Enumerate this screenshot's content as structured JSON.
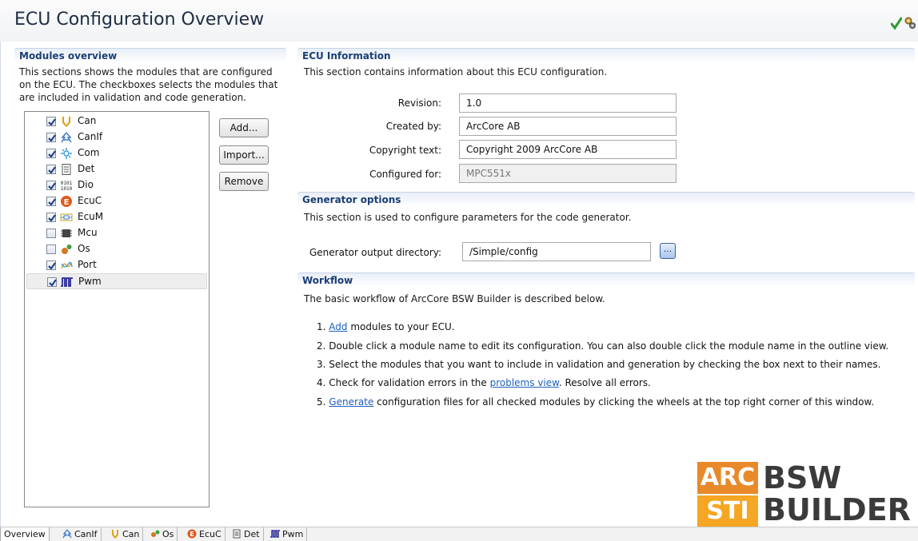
{
  "header": {
    "title": "ECU Configuration Overview"
  },
  "modules_overview": {
    "title": "Modules overview",
    "description_lines": [
      "This sections shows the modules that are configured",
      "on the ECU. The checkboxes selects the modules that",
      "are included in validation and code generation."
    ],
    "modules": [
      {
        "label": "Can",
        "checked": true,
        "icon": "can-icon"
      },
      {
        "label": "CanIf",
        "checked": true,
        "icon": "canif-icon"
      },
      {
        "label": "Com",
        "checked": true,
        "icon": "com-icon"
      },
      {
        "label": "Det",
        "checked": true,
        "icon": "det-icon"
      },
      {
        "label": "Dio",
        "checked": true,
        "icon": "dio-icon"
      },
      {
        "label": "EcuC",
        "checked": true,
        "icon": "ecuc-icon"
      },
      {
        "label": "EcuM",
        "checked": true,
        "icon": "ecum-icon"
      },
      {
        "label": "Mcu",
        "checked": false,
        "icon": "mcu-icon"
      },
      {
        "label": "Os",
        "checked": false,
        "icon": "os-icon"
      },
      {
        "label": "Port",
        "checked": true,
        "icon": "port-icon"
      },
      {
        "label": "Pwm",
        "checked": true,
        "icon": "pwm-icon",
        "selected": true
      }
    ],
    "buttons": {
      "add": "Add...",
      "import": "Import...",
      "remove": "Remove"
    }
  },
  "ecu_info": {
    "title": "ECU Information",
    "description": "This section contains information about this ECU configuration.",
    "revision_label": "Revision:",
    "revision_value": "1.0",
    "created_by_label": "Created by:",
    "created_by_value": "ArcCore AB",
    "copyright_label": "Copyright text:",
    "copyright_value": "Copyright 2009 ArcCore AB",
    "configured_for_label": "Configured for:",
    "configured_for_value": "MPC551x"
  },
  "generator": {
    "title": "Generator options",
    "description": "This section is used to configure parameters for the code generator.",
    "output_dir_label": "Generator output directory:",
    "output_dir_value": "/Simple/config",
    "browse_label": "..."
  },
  "workflow": {
    "title": "Workflow",
    "description": "The basic workflow of ArcCore BSW Builder is described below.",
    "step1_num": "1.",
    "step1_link": "Add",
    "step1_rest": "modules to your ECU.",
    "step2": "2. Double click a module name to edit its configuration. You can also double click the module name in the outline view.",
    "step3": "3. Select the modules that you want to include in validation and generation by checking the box next to their names.",
    "step4_pre": "4. Check for validation errors in the",
    "step4_link": "problems view",
    "step4_post": ". Resolve all errors.",
    "step5_num": "5.",
    "step5_link": "Generate",
    "step5_rest": "configuration files for all checked modules by clicking the wheels at the top right corner of this window."
  },
  "logo": {
    "arc": "ARC",
    "sti": "STI",
    "bsw": "BSW",
    "builder": "BUILDER"
  },
  "tabs": [
    {
      "label": "Overview",
      "active": true
    },
    {
      "label": "CanIf"
    },
    {
      "label": "Can"
    },
    {
      "label": "Os"
    },
    {
      "label": "EcuC"
    },
    {
      "label": "Det"
    },
    {
      "label": "Pwm"
    }
  ],
  "colors": {
    "section_title": "#1a3f75",
    "link": "#1f5fbf",
    "logo_orange": "#e8892a"
  }
}
